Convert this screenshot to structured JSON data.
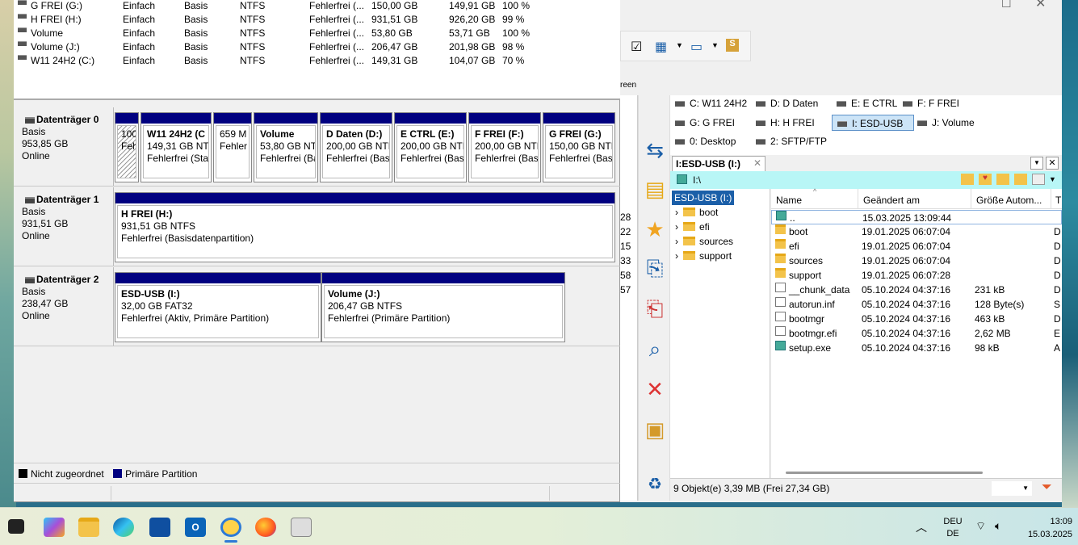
{
  "volumes": [
    {
      "name": "G FREI (G:)",
      "layout": "Einfach",
      "type": "Basis",
      "fs": "NTFS",
      "status": "Fehlerfrei (...",
      "cap": "150,00 GB",
      "free": "149,91 GB",
      "pct": "100 %"
    },
    {
      "name": "H FREI (H:)",
      "layout": "Einfach",
      "type": "Basis",
      "fs": "NTFS",
      "status": "Fehlerfrei (...",
      "cap": "931,51 GB",
      "free": "926,20 GB",
      "pct": "99 %"
    },
    {
      "name": "Volume",
      "layout": "Einfach",
      "type": "Basis",
      "fs": "NTFS",
      "status": "Fehlerfrei (...",
      "cap": "53,80 GB",
      "free": "53,71 GB",
      "pct": "100 %"
    },
    {
      "name": "Volume (J:)",
      "layout": "Einfach",
      "type": "Basis",
      "fs": "NTFS",
      "status": "Fehlerfrei (...",
      "cap": "206,47 GB",
      "free": "201,98 GB",
      "pct": "98 %"
    },
    {
      "name": "W11 24H2 (C:)",
      "layout": "Einfach",
      "type": "Basis",
      "fs": "NTFS",
      "status": "Fehlerfrei (...",
      "cap": "149,31 GB",
      "free": "104,07 GB",
      "pct": "70 %"
    }
  ],
  "disks": [
    {
      "name": "Datenträger 0",
      "type": "Basis",
      "size": "953,85 GB",
      "state": "Online",
      "parts": [
        {
          "l1": "",
          "l2": "100",
          "l3": "Feh"
        },
        {
          "l1": "W11 24H2  (C",
          "l2": "149,31 GB NTF",
          "l3": "Fehlerfrei (Sta"
        },
        {
          "l1": "",
          "l2": "659 M",
          "l3": "Fehler"
        },
        {
          "l1": "Volume",
          "l2": "53,80 GB NTI",
          "l3": "Fehlerfrei (Ba"
        },
        {
          "l1": "D Daten  (D:)",
          "l2": "200,00 GB NTF",
          "l3": "Fehlerfrei (Basi"
        },
        {
          "l1": "E CTRL  (E:)",
          "l2": "200,00 GB NTF",
          "l3": "Fehlerfrei (Basi"
        },
        {
          "l1": "F FREI  (F:)",
          "l2": "200,00 GB NTF",
          "l3": "Fehlerfrei (Basi"
        },
        {
          "l1": "G FREI  (G:)",
          "l2": "150,00 GB NTF",
          "l3": "Fehlerfrei (Basi"
        }
      ]
    },
    {
      "name": "Datenträger 1",
      "type": "Basis",
      "size": "931,51 GB",
      "state": "Online",
      "parts": [
        {
          "l1": "H FREI  (H:)",
          "l2": "931,51 GB NTFS",
          "l3": "Fehlerfrei (Basisdatenpartition)"
        }
      ]
    },
    {
      "name": "Datenträger 2",
      "type": "Basis",
      "size": "238,47 GB",
      "state": "Online",
      "parts": [
        {
          "l1": "ESD-USB  (I:)",
          "l2": "32,00 GB FAT32",
          "l3": "Fehlerfrei (Aktiv, Primäre Partition)"
        },
        {
          "l1": "Volume  (J:)",
          "l2": "206,47 GB NTFS",
          "l3": "Fehlerfrei (Primäre Partition)"
        }
      ]
    }
  ],
  "legend": {
    "unalloc": "Nicht zugeordnet",
    "primary": "Primäre Partition",
    "unalloc_color": "#000000",
    "primary_color": "#000080"
  },
  "tc": {
    "toolbar_label": "reen",
    "drives": [
      "C: W11 24H2",
      "D: D Daten",
      "E: E CTRL",
      "F: F FREI",
      "G: G FREI",
      "H: H FREI",
      "I: ESD-USB",
      "J: Volume",
      "0: Desktop",
      "2: SFTP/FTP"
    ],
    "tab": "I:ESD-USB (I:)",
    "path": "I:\\",
    "tree": [
      "ESD-USB (I:)",
      "boot",
      "efi",
      "sources",
      "support"
    ],
    "columns": {
      "name": "Name",
      "date": "Geändert am",
      "size": "Größe Autom...",
      "type": "T"
    },
    "files": [
      {
        "name": "..",
        "date": "15.03.2025 13:09:44",
        "size": "",
        "t": "",
        "icon": "up"
      },
      {
        "name": "boot",
        "date": "19.01.2025 06:07:04",
        "size": "",
        "t": "D",
        "icon": "folder"
      },
      {
        "name": "efi",
        "date": "19.01.2025 06:07:04",
        "size": "",
        "t": "D",
        "icon": "folder"
      },
      {
        "name": "sources",
        "date": "19.01.2025 06:07:04",
        "size": "",
        "t": "D",
        "icon": "folder"
      },
      {
        "name": "support",
        "date": "19.01.2025 06:07:28",
        "size": "",
        "t": "D",
        "icon": "folder"
      },
      {
        "name": "__chunk_data",
        "date": "05.10.2024 04:37:16",
        "size": "231 kB",
        "t": "D",
        "icon": "file"
      },
      {
        "name": "autorun.inf",
        "date": "05.10.2024 04:37:16",
        "size": "128 Byte(s)",
        "t": "S",
        "icon": "file"
      },
      {
        "name": "bootmgr",
        "date": "05.10.2024 04:37:16",
        "size": "463 kB",
        "t": "D",
        "icon": "file"
      },
      {
        "name": "bootmgr.efi",
        "date": "05.10.2024 04:37:16",
        "size": "2,62 MB",
        "t": "E",
        "icon": "file"
      },
      {
        "name": "setup.exe",
        "date": "05.10.2024 04:37:16",
        "size": "98 kB",
        "t": "A",
        "icon": "exe"
      }
    ],
    "status": "9 Objekt(e)  3,39 MB  (Frei 27,34 GB)",
    "peek": [
      "28",
      "22",
      "15",
      "33",
      "58",
      "57"
    ]
  },
  "taskbar": {
    "lang1": "DEU",
    "lang2": "DE",
    "time": "13:09",
    "date": "15.03.2025"
  }
}
